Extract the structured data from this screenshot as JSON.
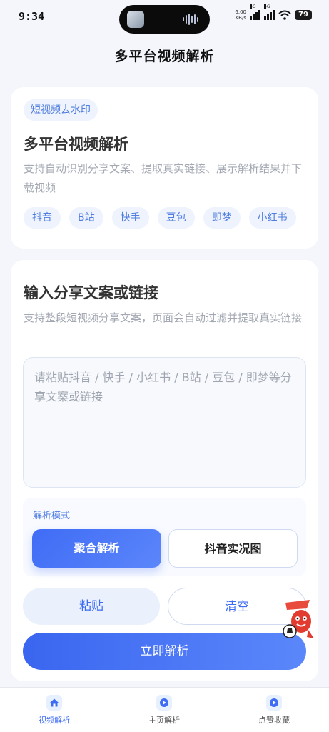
{
  "status": {
    "time": "9:34",
    "netspeed_value": "6.00",
    "netspeed_unit": "KB/s",
    "sim1": "5G",
    "sim2": "5G",
    "battery": "79"
  },
  "header": {
    "title": "多平台视频解析"
  },
  "intro": {
    "tag": "短视频去水印",
    "title": "多平台视频解析",
    "description": "支持自动识别分享文案、提取真实链接、展示解析结果并下载视频",
    "platforms": [
      "抖音",
      "B站",
      "快手",
      "豆包",
      "即梦",
      "小红书"
    ]
  },
  "input_section": {
    "title": "输入分享文案或链接",
    "description": "支持整段短视频分享文案，页面会自动过滤并提取真实链接",
    "placeholder": "请粘贴抖音 / 快手 / 小红书 / B站 / 豆包 / 即梦等分享文案或链接",
    "mode_label": "解析模式",
    "mode_options": [
      "聚合解析",
      "抖音实况图"
    ],
    "selected_mode": "聚合解析",
    "paste_label": "粘贴",
    "clear_label": "清空",
    "submit_label": "立即解析"
  },
  "tabbar": {
    "items": [
      {
        "label": "视频解析",
        "icon": "home-icon",
        "active": true
      },
      {
        "label": "主页解析",
        "icon": "play-icon",
        "active": false
      },
      {
        "label": "点赞收藏",
        "icon": "play-icon",
        "active": false
      }
    ]
  },
  "colors": {
    "accent": "#3f6cf5",
    "tag_bg": "#eef3fd",
    "background": "#f4f6fb"
  }
}
